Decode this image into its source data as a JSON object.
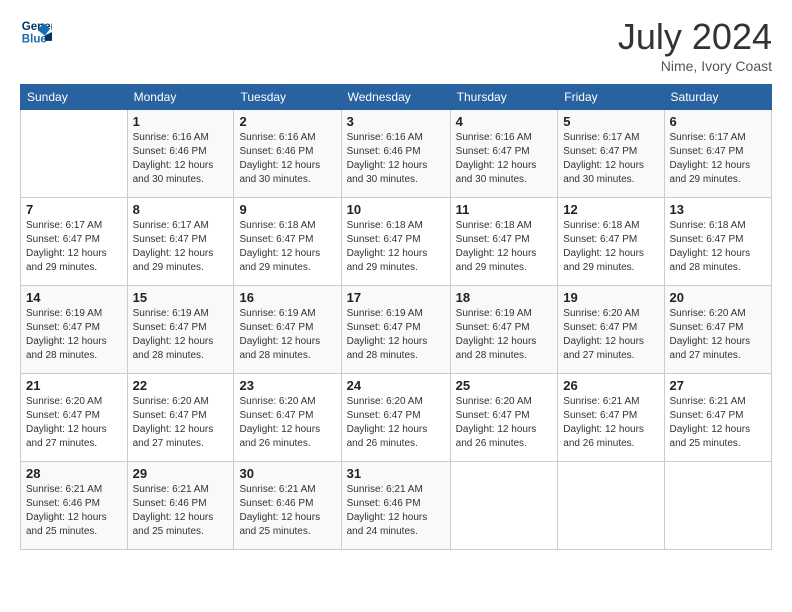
{
  "header": {
    "logo_line1": "General",
    "logo_line2": "Blue",
    "title": "July 2024",
    "subtitle": "Nime, Ivory Coast"
  },
  "calendar": {
    "days_of_week": [
      "Sunday",
      "Monday",
      "Tuesday",
      "Wednesday",
      "Thursday",
      "Friday",
      "Saturday"
    ],
    "weeks": [
      [
        {
          "day": "",
          "info": ""
        },
        {
          "day": "1",
          "info": "Sunrise: 6:16 AM\nSunset: 6:46 PM\nDaylight: 12 hours\nand 30 minutes."
        },
        {
          "day": "2",
          "info": "Sunrise: 6:16 AM\nSunset: 6:46 PM\nDaylight: 12 hours\nand 30 minutes."
        },
        {
          "day": "3",
          "info": "Sunrise: 6:16 AM\nSunset: 6:46 PM\nDaylight: 12 hours\nand 30 minutes."
        },
        {
          "day": "4",
          "info": "Sunrise: 6:16 AM\nSunset: 6:47 PM\nDaylight: 12 hours\nand 30 minutes."
        },
        {
          "day": "5",
          "info": "Sunrise: 6:17 AM\nSunset: 6:47 PM\nDaylight: 12 hours\nand 30 minutes."
        },
        {
          "day": "6",
          "info": "Sunrise: 6:17 AM\nSunset: 6:47 PM\nDaylight: 12 hours\nand 29 minutes."
        }
      ],
      [
        {
          "day": "7",
          "info": "Sunrise: 6:17 AM\nSunset: 6:47 PM\nDaylight: 12 hours\nand 29 minutes."
        },
        {
          "day": "8",
          "info": "Sunrise: 6:17 AM\nSunset: 6:47 PM\nDaylight: 12 hours\nand 29 minutes."
        },
        {
          "day": "9",
          "info": "Sunrise: 6:18 AM\nSunset: 6:47 PM\nDaylight: 12 hours\nand 29 minutes."
        },
        {
          "day": "10",
          "info": "Sunrise: 6:18 AM\nSunset: 6:47 PM\nDaylight: 12 hours\nand 29 minutes."
        },
        {
          "day": "11",
          "info": "Sunrise: 6:18 AM\nSunset: 6:47 PM\nDaylight: 12 hours\nand 29 minutes."
        },
        {
          "day": "12",
          "info": "Sunrise: 6:18 AM\nSunset: 6:47 PM\nDaylight: 12 hours\nand 29 minutes."
        },
        {
          "day": "13",
          "info": "Sunrise: 6:18 AM\nSunset: 6:47 PM\nDaylight: 12 hours\nand 28 minutes."
        }
      ],
      [
        {
          "day": "14",
          "info": "Sunrise: 6:19 AM\nSunset: 6:47 PM\nDaylight: 12 hours\nand 28 minutes."
        },
        {
          "day": "15",
          "info": "Sunrise: 6:19 AM\nSunset: 6:47 PM\nDaylight: 12 hours\nand 28 minutes."
        },
        {
          "day": "16",
          "info": "Sunrise: 6:19 AM\nSunset: 6:47 PM\nDaylight: 12 hours\nand 28 minutes."
        },
        {
          "day": "17",
          "info": "Sunrise: 6:19 AM\nSunset: 6:47 PM\nDaylight: 12 hours\nand 28 minutes."
        },
        {
          "day": "18",
          "info": "Sunrise: 6:19 AM\nSunset: 6:47 PM\nDaylight: 12 hours\nand 28 minutes."
        },
        {
          "day": "19",
          "info": "Sunrise: 6:20 AM\nSunset: 6:47 PM\nDaylight: 12 hours\nand 27 minutes."
        },
        {
          "day": "20",
          "info": "Sunrise: 6:20 AM\nSunset: 6:47 PM\nDaylight: 12 hours\nand 27 minutes."
        }
      ],
      [
        {
          "day": "21",
          "info": "Sunrise: 6:20 AM\nSunset: 6:47 PM\nDaylight: 12 hours\nand 27 minutes."
        },
        {
          "day": "22",
          "info": "Sunrise: 6:20 AM\nSunset: 6:47 PM\nDaylight: 12 hours\nand 27 minutes."
        },
        {
          "day": "23",
          "info": "Sunrise: 6:20 AM\nSunset: 6:47 PM\nDaylight: 12 hours\nand 26 minutes."
        },
        {
          "day": "24",
          "info": "Sunrise: 6:20 AM\nSunset: 6:47 PM\nDaylight: 12 hours\nand 26 minutes."
        },
        {
          "day": "25",
          "info": "Sunrise: 6:20 AM\nSunset: 6:47 PM\nDaylight: 12 hours\nand 26 minutes."
        },
        {
          "day": "26",
          "info": "Sunrise: 6:21 AM\nSunset: 6:47 PM\nDaylight: 12 hours\nand 26 minutes."
        },
        {
          "day": "27",
          "info": "Sunrise: 6:21 AM\nSunset: 6:47 PM\nDaylight: 12 hours\nand 25 minutes."
        }
      ],
      [
        {
          "day": "28",
          "info": "Sunrise: 6:21 AM\nSunset: 6:46 PM\nDaylight: 12 hours\nand 25 minutes."
        },
        {
          "day": "29",
          "info": "Sunrise: 6:21 AM\nSunset: 6:46 PM\nDaylight: 12 hours\nand 25 minutes."
        },
        {
          "day": "30",
          "info": "Sunrise: 6:21 AM\nSunset: 6:46 PM\nDaylight: 12 hours\nand 25 minutes."
        },
        {
          "day": "31",
          "info": "Sunrise: 6:21 AM\nSunset: 6:46 PM\nDaylight: 12 hours\nand 24 minutes."
        },
        {
          "day": "",
          "info": ""
        },
        {
          "day": "",
          "info": ""
        },
        {
          "day": "",
          "info": ""
        }
      ]
    ]
  }
}
